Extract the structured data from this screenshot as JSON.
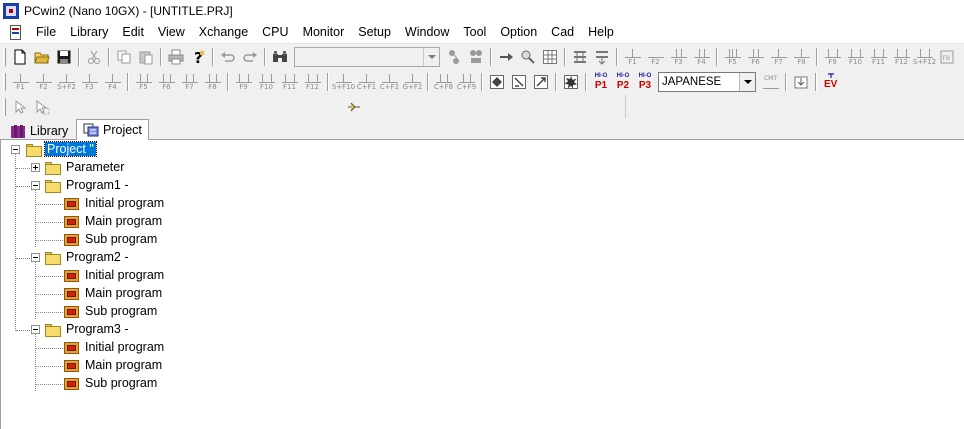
{
  "window": {
    "title": "PCwin2 (Nano 10GX)  - [UNTITLE.PRJ]"
  },
  "menu": {
    "items": [
      "File",
      "Library",
      "Edit",
      "View",
      "Xchange",
      "CPU",
      "Monitor",
      "Setup",
      "Window",
      "Tool",
      "Option",
      "Cad",
      "Help"
    ]
  },
  "toolbar": {
    "fkeys_row1": [
      "F1",
      "F2",
      "F3",
      "F4",
      "F5",
      "F6",
      "F7",
      "F8",
      "F9",
      "F10",
      "F11",
      "F12",
      "S+F12"
    ],
    "fkeys_row2": [
      "F1",
      "F2",
      "S+F2",
      "F3",
      "F4",
      "F5",
      "F6",
      "F7",
      "F8",
      "F9",
      "F10",
      "F11",
      "F12",
      "S+F10",
      "C+F1",
      "C+F2",
      "G+F2",
      "C+F8",
      "C+F9"
    ],
    "p_buttons": [
      {
        "top": "HI-O",
        "bottom": "P1"
      },
      {
        "top": "HI-O",
        "bottom": "P2"
      },
      {
        "top": "HI-O",
        "bottom": "P3"
      }
    ],
    "language_select": {
      "value": "JAPANESE"
    },
    "cmt_label": "CMT",
    "ev_label": "EV",
    "accent_red": "#d00000",
    "accent_blue": "#1a1aa8"
  },
  "tabs": [
    {
      "label": "Library",
      "icon": "library-books-icon",
      "active": false
    },
    {
      "label": "Project",
      "icon": "project-tree-icon",
      "active": true
    }
  ],
  "tree": {
    "root": {
      "label": "Project \"",
      "expanded": true,
      "selected": true
    },
    "parameter": {
      "label": "Parameter",
      "expanded": false
    },
    "programs": [
      {
        "label": "Program1 -",
        "children": [
          "Initial program",
          "Main program",
          "Sub program"
        ]
      },
      {
        "label": "Program2 -",
        "children": [
          "Initial program",
          "Main program",
          "Sub program"
        ]
      },
      {
        "label": "Program3 -",
        "children": [
          "Initial program",
          "Main program",
          "Sub program"
        ]
      }
    ]
  }
}
